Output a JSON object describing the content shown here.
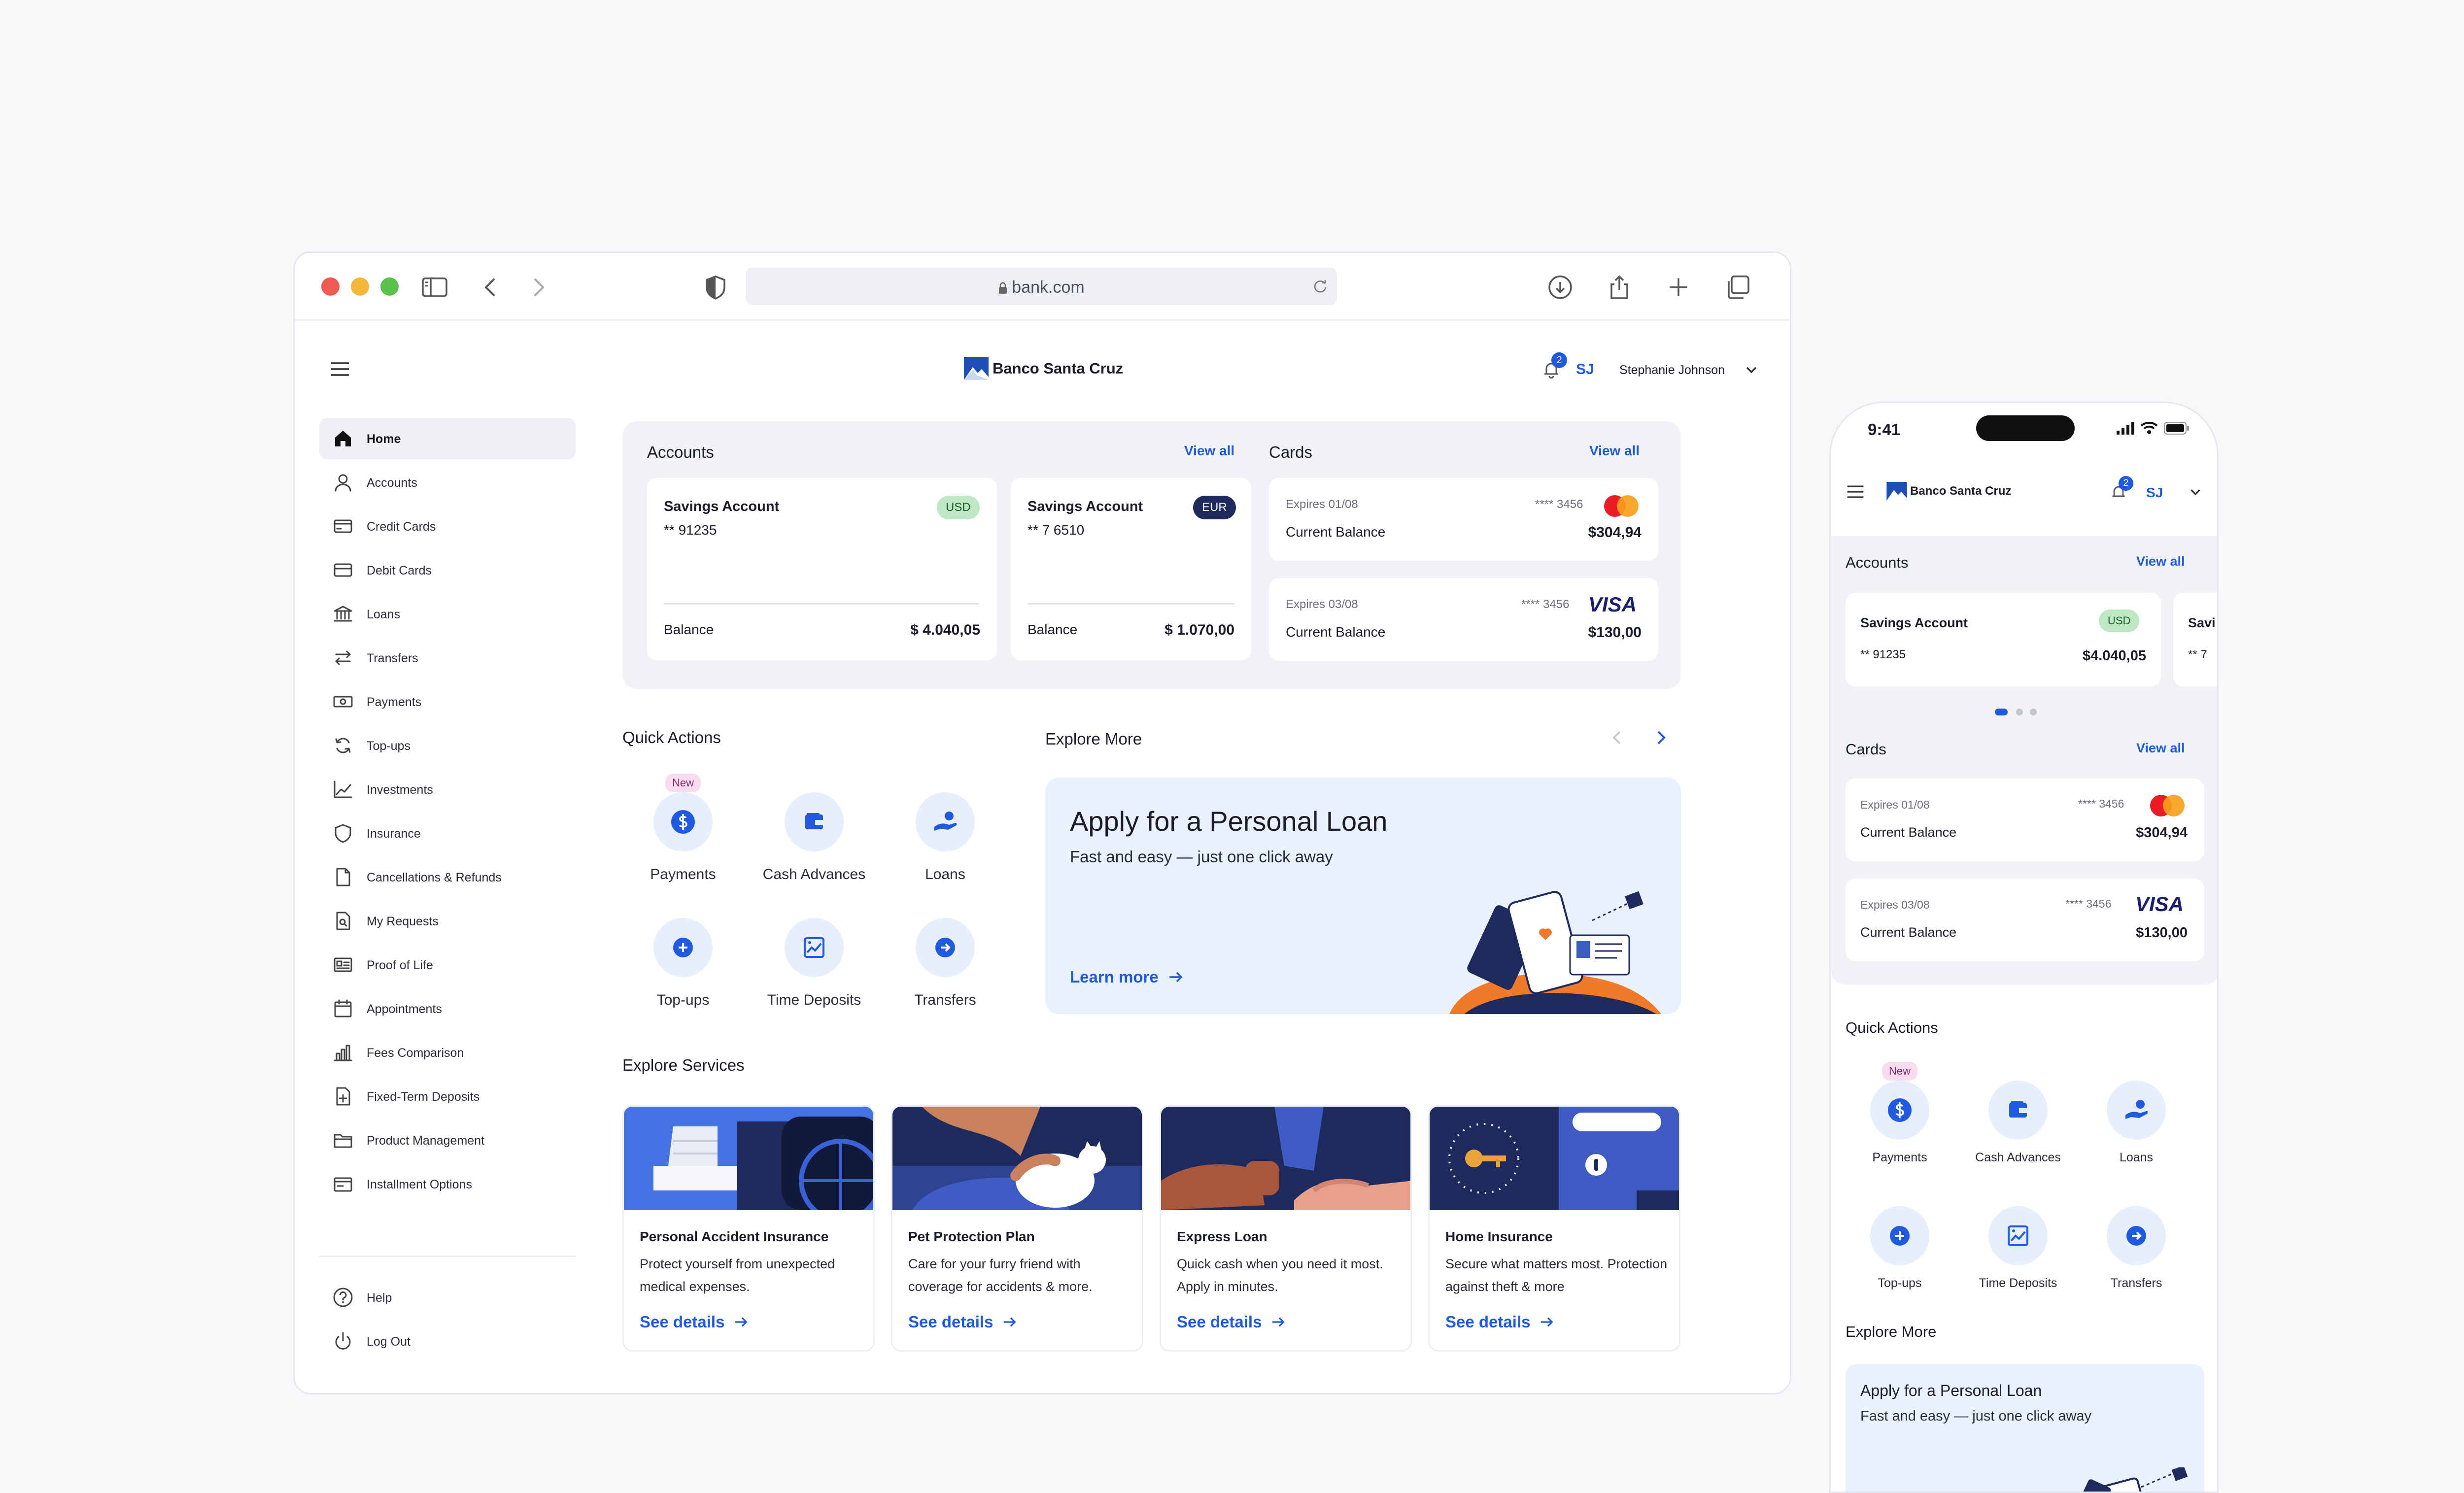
{
  "browser": {
    "url": "bank.com"
  },
  "app": {
    "brand": "Banco Santa Cruz",
    "notif_count": "2",
    "user_initials": "SJ",
    "user_name": "Stephanie Johnson"
  },
  "sidebar": {
    "items": [
      {
        "label": "Home",
        "icon": "home-icon"
      },
      {
        "label": "Accounts",
        "icon": "user-icon"
      },
      {
        "label": "Credit Cards",
        "icon": "credit-card-icon"
      },
      {
        "label": "Debit Cards",
        "icon": "debit-card-icon"
      },
      {
        "label": "Loans",
        "icon": "bank-icon"
      },
      {
        "label": "Transfers",
        "icon": "transfer-icon"
      },
      {
        "label": "Payments",
        "icon": "cash-icon"
      },
      {
        "label": "Top-ups",
        "icon": "refresh-icon"
      },
      {
        "label": "Investments",
        "icon": "trend-icon"
      },
      {
        "label": "Insurance",
        "icon": "shield-icon"
      },
      {
        "label": "Cancellations & Refunds",
        "icon": "document-icon"
      },
      {
        "label": "My Requests",
        "icon": "request-icon"
      },
      {
        "label": "Proof of Life",
        "icon": "id-card-icon"
      },
      {
        "label": "Appointments",
        "icon": "calendar-icon"
      },
      {
        "label": "Fees Comparison",
        "icon": "bar-chart-icon"
      },
      {
        "label": "Fixed-Term Deposits",
        "icon": "deposit-icon"
      },
      {
        "label": "Product Management",
        "icon": "folder-icon"
      },
      {
        "label": "Installment Options",
        "icon": "wallet-icon"
      }
    ],
    "help": "Help",
    "logout": "Log Out"
  },
  "accounts": {
    "title": "Accounts",
    "view_all": "View all",
    "items": [
      {
        "name": "Savings Account",
        "number": "** 91235",
        "currency": "USD",
        "balance_label": "Balance",
        "balance": "$ 4.040,05"
      },
      {
        "name": "Savings Account",
        "number": "** 7 6510",
        "currency": "EUR",
        "balance_label": "Balance",
        "balance": "$ 1.070,00"
      }
    ]
  },
  "cards": {
    "title": "Cards",
    "view_all": "View all",
    "items": [
      {
        "expires": "Expires 01/08",
        "masked": "**** 3456",
        "label": "Current Balance",
        "balance": "$304,94",
        "brand": "mastercard"
      },
      {
        "expires": "Expires 03/08",
        "masked": "**** 3456",
        "label": "Current Balance",
        "balance": "$130,00",
        "brand": "VISA"
      }
    ]
  },
  "quick_actions": {
    "title": "Quick Actions",
    "new_badge": "New",
    "items": [
      {
        "label": "Payments",
        "icon": "dollar-icon"
      },
      {
        "label": "Cash Advances",
        "icon": "wallet-icon"
      },
      {
        "label": "Loans",
        "icon": "hand-coin-icon"
      },
      {
        "label": "Top-ups",
        "icon": "plus-icon"
      },
      {
        "label": "Time Deposits",
        "icon": "chart-image-icon"
      },
      {
        "label": "Transfers",
        "icon": "arrow-right-icon"
      }
    ]
  },
  "explore": {
    "title": "Explore More",
    "promo_title": "Apply for a Personal Loan",
    "promo_sub": "Fast and easy — just one click away",
    "learn_more": "Learn more"
  },
  "services": {
    "title": "Explore Services",
    "items": [
      {
        "title": "Personal Accident Insurance",
        "desc": "Protect yourself from unexpected medical expenses.",
        "link": "See details"
      },
      {
        "title": "Pet Protection Plan",
        "desc": "Care for your furry friend with coverage for accidents & more.",
        "link": "See details"
      },
      {
        "title": "Express Loan",
        "desc": "Quick cash when you need it most. Apply in minutes.",
        "link": "See details"
      },
      {
        "title": "Home Insurance",
        "desc": "Secure what matters most. Protection against theft & more",
        "link": "See details"
      }
    ]
  },
  "phone": {
    "time": "9:41",
    "accounts_title": "Accounts",
    "view_all": "View all",
    "account": {
      "name": "Savings Account",
      "number": "** 91235",
      "currency": "USD",
      "balance": "$4.040,05"
    },
    "peek_name": "Savi",
    "peek_number": "** 7",
    "cards_title": "Cards",
    "cards": [
      {
        "expires": "Expires 01/08",
        "masked": "**** 3456",
        "label": "Current Balance",
        "balance": "$304,94"
      },
      {
        "expires": "Expires 03/08",
        "masked": "**** 3456",
        "label": "Current Balance",
        "balance": "$130,00"
      }
    ],
    "quick_actions_title": "Quick Actions",
    "explore_title": "Explore More",
    "promo_title": "Apply for a Personal Loan",
    "promo_sub": "Fast and easy — just one click away"
  },
  "colors": {
    "accent": "#1f5ae0",
    "navy": "#1e2a5c",
    "panel": "#f1f2f5",
    "promo": "#e9f1fc",
    "orange": "#f07a2a"
  }
}
